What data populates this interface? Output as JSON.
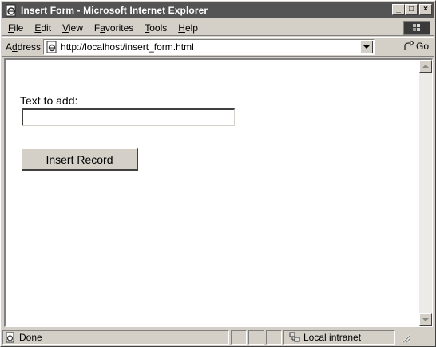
{
  "window": {
    "title": "Insert Form - Microsoft Internet Explorer",
    "buttons": {
      "minimize": "_",
      "maximize": "□",
      "close": "×"
    }
  },
  "menubar": {
    "items": [
      {
        "u": "F",
        "rest": "ile"
      },
      {
        "u": "E",
        "rest": "dit"
      },
      {
        "u": "V",
        "rest": "iew"
      },
      {
        "pre": "F",
        "u": "a",
        "rest": "vorites"
      },
      {
        "u": "T",
        "rest": "ools"
      },
      {
        "u": "H",
        "rest": "elp"
      }
    ]
  },
  "addressbar": {
    "label_pre": "A",
    "label_u": "d",
    "label_rest": "dress",
    "url": "http://localhost/insert_form.html",
    "go_label": "Go"
  },
  "form": {
    "label": "Text to add:",
    "input_value": "",
    "submit_label": "Insert Record"
  },
  "statusbar": {
    "status": "Done",
    "zone": "Local intranet"
  },
  "icons": {
    "app": "ie-page-icon",
    "address_page": "ie-page-icon",
    "go": "go-arrow-icon",
    "status": "page-done-icon",
    "zone": "local-intranet-icon"
  }
}
